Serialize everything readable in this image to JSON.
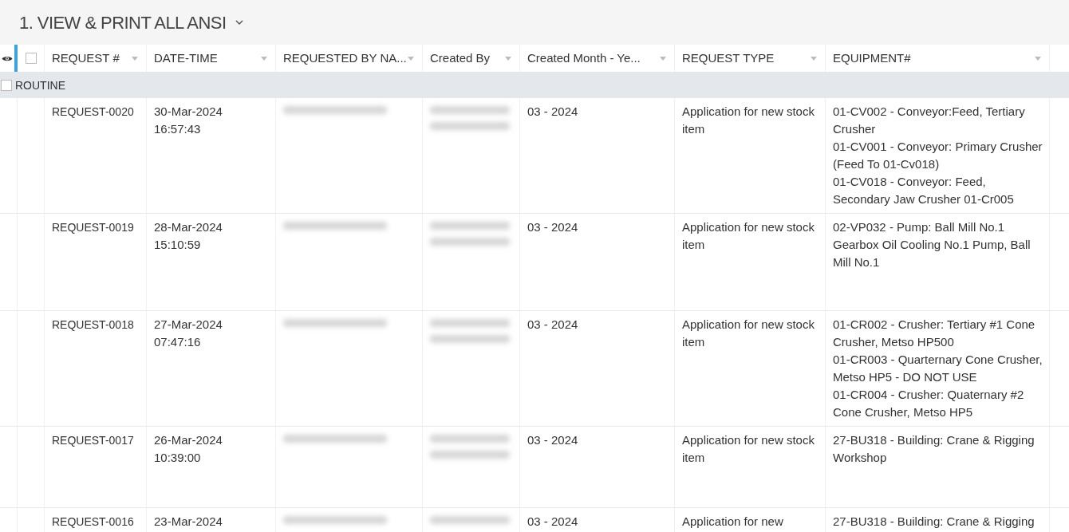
{
  "view_title": "1. VIEW & PRINT ALL ANSI",
  "columns": [
    {
      "label": "REQUEST #"
    },
    {
      "label": "DATE-TIME"
    },
    {
      "label": "REQUESTED BY NA..."
    },
    {
      "label": "Created By"
    },
    {
      "label": "Created Month - Ye..."
    },
    {
      "label": "REQUEST TYPE"
    },
    {
      "label": "EQUIPMENT#"
    }
  ],
  "group": {
    "label": "ROUTINE",
    "checked": false
  },
  "header_checked": false,
  "rows": [
    {
      "request": "REQUEST-0020",
      "date": "30-Mar-2024",
      "time": "16:57:43",
      "month": "03 - 2024",
      "type": "Application for new stock item",
      "equipment": [
        "01-CV002 - Conveyor:Feed, Tertiary Crusher",
        "01-CV001 - Conveyor: Primary Crusher (Feed To 01-Cv018)",
        "01-CV018 - Conveyor: Feed, Secondary Jaw Crusher 01-Cr005"
      ]
    },
    {
      "request": "REQUEST-0019",
      "date": "28-Mar-2024",
      "time": "15:10:59",
      "month": "03 - 2024",
      "type": "Application for new stock item",
      "equipment": [
        "02-VP032 - Pump: Ball Mill No.1 Gearbox Oil Cooling No.1 Pump, Ball Mill No.1"
      ]
    },
    {
      "request": "REQUEST-0018",
      "date": "27-Mar-2024",
      "time": "07:47:16",
      "month": "03 - 2024",
      "type": "Application for new stock item",
      "equipment": [
        "01-CR002 - Crusher: Tertiary #1 Cone Crusher, Metso HP500",
        "01-CR003 - Quarternary Cone Crusher, Metso HP5 - DO NOT USE",
        "01-CR004 - Crusher: Quaternary #2 Cone Crusher, Metso HP5"
      ]
    },
    {
      "request": "REQUEST-0017",
      "date": "26-Mar-2024",
      "time": "10:39:00",
      "month": "03 - 2024",
      "type": "Application for new stock item",
      "equipment": [
        "27-BU318 - Building: Crane & Rigging Workshop"
      ]
    },
    {
      "request": "REQUEST-0016",
      "date": "23-Mar-2024",
      "month": "03 - 2024",
      "type": "Application for new",
      "equipment": [
        "27-BU318 - Building: Crane & Rigging"
      ]
    }
  ]
}
